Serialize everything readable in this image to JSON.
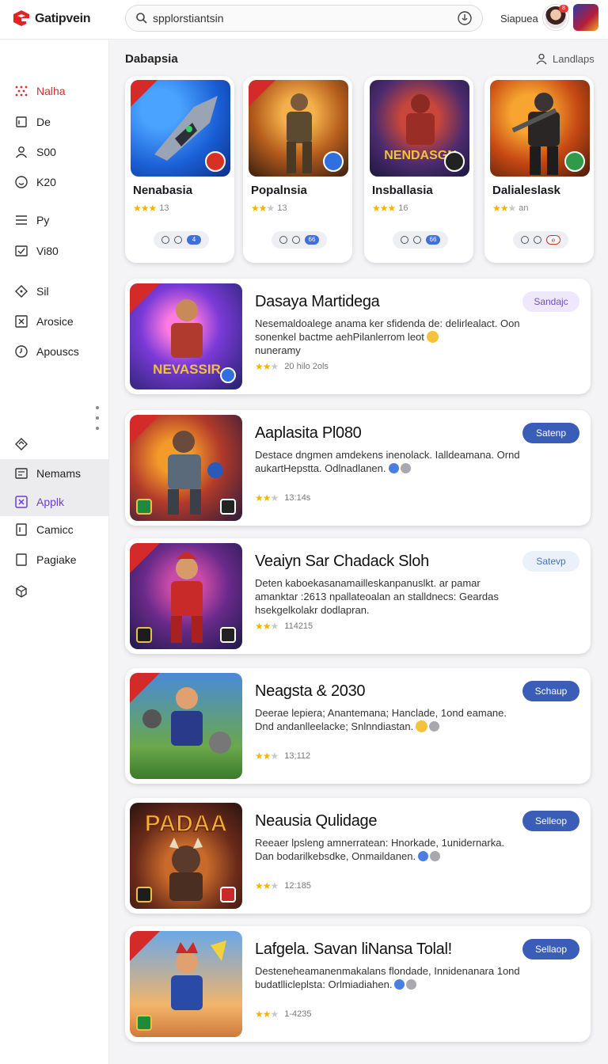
{
  "header": {
    "logo_text": "Gatipvein",
    "search_value": "spplorstiantsin",
    "user_name": "Siapuea",
    "avatar_badge": "8"
  },
  "sidebar": {
    "items": [
      {
        "label": "Nalha",
        "icon": "grid-dots-icon"
      },
      {
        "label": "De",
        "icon": "square-icon"
      },
      {
        "label": "S00",
        "icon": "person-icon"
      },
      {
        "label": "K20",
        "icon": "smile-icon"
      },
      {
        "label": "Py",
        "icon": "menu-lines-icon"
      },
      {
        "label": "Vi80",
        "icon": "check-square-icon"
      },
      {
        "label": "Sil",
        "icon": "tag-icon"
      },
      {
        "label": "Arosice",
        "icon": "x-square-icon"
      },
      {
        "label": "Apouscs",
        "icon": "clock-icon"
      },
      {
        "label": "Nemams",
        "icon": "doc-icon"
      },
      {
        "label": "Applk",
        "icon": "apps-icon"
      },
      {
        "label": "Camicc",
        "icon": "bookmark-icon"
      },
      {
        "label": "Pagiake",
        "icon": "page-icon"
      }
    ]
  },
  "section": {
    "title": "Dabapsia",
    "link": "Landlaps"
  },
  "top_cards": [
    {
      "name": "Nenabasia",
      "rating_text": "13",
      "stars": 3,
      "pill_tag": "4"
    },
    {
      "name": "Popalnsia",
      "rating_text": "13",
      "stars": 2,
      "pill_tag": "66"
    },
    {
      "name": "Insballasia",
      "rating_text": "16",
      "stars": 3,
      "pill_tag": "66"
    },
    {
      "name": "Dalialeslask",
      "rating_text": "an",
      "stars": 2,
      "pill_tag": "e"
    }
  ],
  "list_cards": [
    {
      "title": "Dasaya Martidega",
      "desc": "Nesemaldoalege anama ker sfidenda de: delirlealact. Oon sonenkel bactme aehPilanlerrom leot",
      "desc2": "nuneramy",
      "rating_text": "20 hilo 2ols",
      "stars": 2,
      "button": "Sandajc",
      "button_style": "soft-purple"
    },
    {
      "title": "Aaplasita Pl080",
      "desc": "Destace dngmen amdekens inenolack. Ialldeamana. Ornd aukartHepstta. Odlnadlanen.",
      "rating_text": "13:14s",
      "stars": 2,
      "button": "Satenp",
      "button_style": "solid"
    },
    {
      "title": "Veaiyn Sar Chadack Sloh",
      "desc": "Deten kaboekasanamailleskanpanuslkt. ar pamar amanktar :2613 npallateoalan an stalldnecs: Geardas hsekgelkolakr dodlapran.",
      "rating_text": "114215",
      "stars": 2,
      "button": "Satevp",
      "button_style": "soft-blue"
    },
    {
      "title": "Neagsta & 2030",
      "desc": "Deerae lepiera; Anantemana; Hanclade, 1ond eamane. Dnd andanlleelacke; Snlnndiastan.",
      "rating_text": "13;112",
      "stars": 2,
      "button": "Schaup",
      "button_style": "solid"
    },
    {
      "title": "Neausia Qulidage",
      "desc": "Reeaer lpsleng amnerratean: Hnorkade, 1unidernarka. Dan bodarilkebsdke, Onmaildanen.",
      "rating_text": "12:185",
      "stars": 2,
      "button": "Selleop",
      "button_style": "solid"
    },
    {
      "title": "Lafgela. Savan liNansa Tolal!",
      "desc": "Desteneheamanenmakalans flondade, Innidenanara 1ond budatllicleplsta: Orlmiadiahen.",
      "rating_text": "1-4235",
      "stars": 2,
      "button": "Sellaop",
      "button_style": "solid"
    }
  ],
  "colors": {
    "accent": "#3a5db8",
    "brand_red": "#d32f2f",
    "star": "#f4b400",
    "purple": "#6a3fd4"
  }
}
